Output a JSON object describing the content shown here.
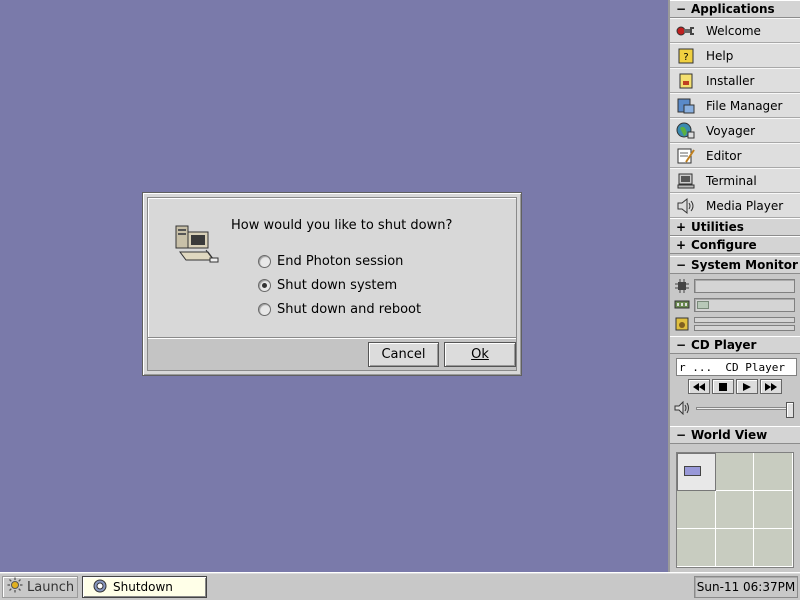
{
  "dialog": {
    "question": "How would you like to shut down?",
    "options": [
      {
        "label": "End Photon session",
        "checked": false
      },
      {
        "label": "Shut down system",
        "checked": true
      },
      {
        "label": "Shut down and reboot",
        "checked": false
      }
    ],
    "cancel_label": "Cancel",
    "ok_label": "Ok"
  },
  "shelf": {
    "applications": {
      "header": "Applications",
      "toggle": "−",
      "items": [
        {
          "label": "Welcome",
          "icon": "welcome-icon"
        },
        {
          "label": "Help",
          "icon": "help-icon"
        },
        {
          "label": "Installer",
          "icon": "installer-icon"
        },
        {
          "label": "File Manager",
          "icon": "file-manager-icon"
        },
        {
          "label": "Voyager",
          "icon": "voyager-icon"
        },
        {
          "label": "Editor",
          "icon": "editor-icon"
        },
        {
          "label": "Terminal",
          "icon": "terminal-icon"
        },
        {
          "label": "Media Player",
          "icon": "media-player-icon"
        }
      ]
    },
    "utilities": {
      "header": "Utilities",
      "toggle": "+"
    },
    "configure": {
      "header": "Configure",
      "toggle": "+"
    },
    "system_monitor": {
      "header": "System Monitor",
      "toggle": "−",
      "memory_level": 0.12
    },
    "cd_player": {
      "header": "CD Player",
      "toggle": "−",
      "display": "r ...  CD Player",
      "volume_level": 1.0
    },
    "world_view": {
      "header": "World View",
      "toggle": "−"
    }
  },
  "taskbar": {
    "launch_label": "Launch",
    "task_label": "Shutdown",
    "clock": "Sun-11 06:37PM"
  },
  "colors": {
    "desktop": "#7a7aaa",
    "panel": "#c8c8c8",
    "task_active": "#ffffe8"
  }
}
